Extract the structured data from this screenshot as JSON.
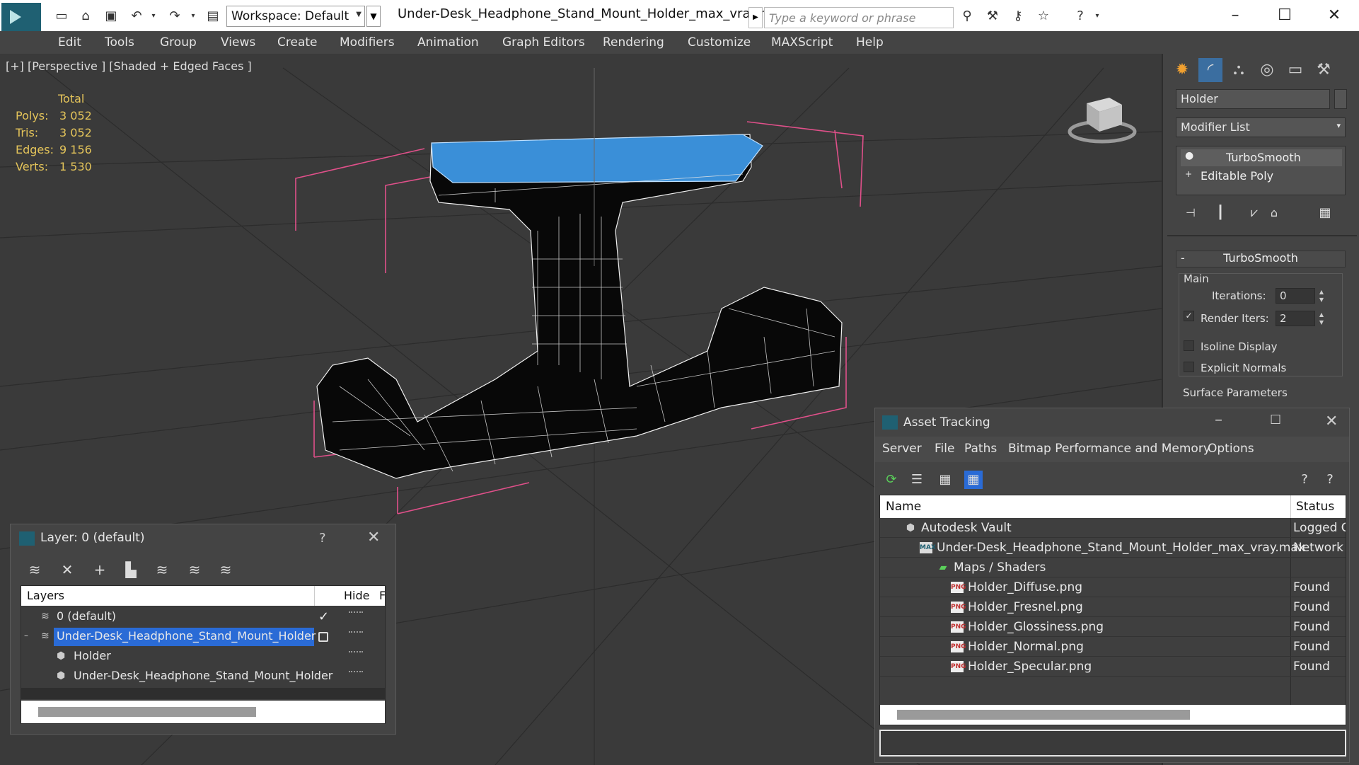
{
  "titlebar": {
    "workspace": "Workspace: Default",
    "document_title": "Under-Desk_Headphone_Stand_Mount_Holder_max_vray.max",
    "search_placeholder": "Type a keyword or phrase"
  },
  "menu": [
    "Edit",
    "Tools",
    "Group",
    "Views",
    "Create",
    "Modifiers",
    "Animation",
    "Graph Editors",
    "Rendering",
    "Customize",
    "MAXScript",
    "Help"
  ],
  "viewport": {
    "label": "[+] [Perspective ] [Shaded + Edged Faces ]",
    "stats_header": "Total",
    "stats": [
      {
        "key": "Polys:",
        "value": "3 052"
      },
      {
        "key": "Tris:",
        "value": "3 052"
      },
      {
        "key": "Edges:",
        "value": "9 156"
      },
      {
        "key": "Verts:",
        "value": "1 530"
      }
    ]
  },
  "command_panel": {
    "object_name": "Holder",
    "modifier_list": "Modifier List",
    "stack": [
      "TurboSmooth",
      "Editable Poly"
    ],
    "rollout_title": "TurboSmooth",
    "group_main": "Main",
    "iterations_label": "Iterations:",
    "iterations_value": "0",
    "render_iters_label": "Render Iters:",
    "render_iters_value": "2",
    "render_iters_checked": "✓",
    "isoline_label": "Isoline Display",
    "explicit_normals_label": "Explicit Normals",
    "surface_params_label": "Surface Parameters"
  },
  "layer_dialog": {
    "title": "Layer: 0 (default)",
    "help": "?",
    "col_layers": "Layers",
    "col_hide": "Hide",
    "col_f": "F",
    "rows": [
      {
        "name": "0 (default)",
        "check": "✓"
      },
      {
        "name": "Under-Desk_Headphone_Stand_Mount_Holder",
        "expand": "–"
      },
      {
        "name": "Holder"
      },
      {
        "name": "Under-Desk_Headphone_Stand_Mount_Holder"
      }
    ]
  },
  "asset_tracking": {
    "title": "Asset Tracking",
    "menu": [
      "Server",
      "File",
      "Paths",
      "Bitmap Performance and Memory",
      "Options"
    ],
    "col_name": "Name",
    "col_status": "Status",
    "rows": [
      {
        "name": "Autodesk Vault",
        "status": "Logged C",
        "icon": "vault-icon"
      },
      {
        "name": "Under-Desk_Headphone_Stand_Mount_Holder_max_vray.max",
        "status": "Network",
        "icon": "max-file-icon"
      },
      {
        "name": "Maps / Shaders",
        "status": "",
        "icon": "maps-folder-icon"
      },
      {
        "name": "Holder_Diffuse.png",
        "status": "Found",
        "icon": "png-icon"
      },
      {
        "name": "Holder_Fresnel.png",
        "status": "Found",
        "icon": "png-icon"
      },
      {
        "name": "Holder_Glossiness.png",
        "status": "Found",
        "icon": "png-icon"
      },
      {
        "name": "Holder_Normal.png",
        "status": "Found",
        "icon": "png-icon"
      },
      {
        "name": "Holder_Specular.png",
        "status": "Found",
        "icon": "png-icon"
      }
    ],
    "file_badge_max": "MAX",
    "file_badge_png": "PNG"
  },
  "colors": {
    "selection_blue": "#2a6bd6",
    "stats_yellow": "#e4c45a",
    "bbox_pink": "#e0508a",
    "selected_face_blue": "#3a8fd8"
  }
}
